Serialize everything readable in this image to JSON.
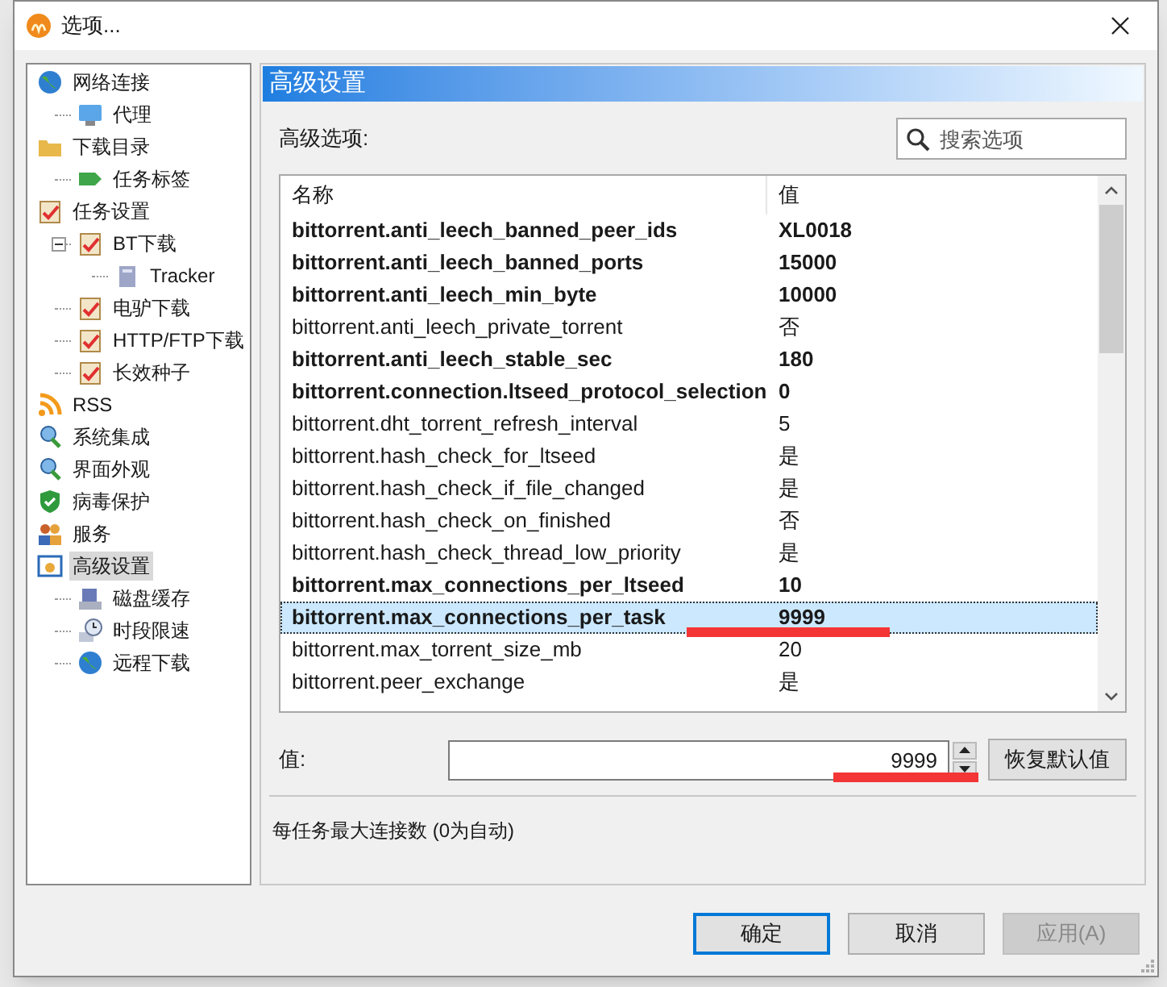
{
  "window": {
    "title": "选项..."
  },
  "tree": [
    {
      "label": "网络连接",
      "selected": false,
      "children": [
        {
          "label": "代理",
          "selected": false
        }
      ]
    },
    {
      "label": "下载目录",
      "selected": false,
      "children": [
        {
          "label": "任务标签",
          "selected": false
        }
      ]
    },
    {
      "label": "任务设置",
      "selected": false,
      "children": [
        {
          "label": "BT下载",
          "selected": false,
          "expanded": true,
          "children": [
            {
              "label": "Tracker",
              "selected": false
            }
          ]
        },
        {
          "label": "电驴下载",
          "selected": false
        },
        {
          "label": "HTTP/FTP下载",
          "selected": false
        },
        {
          "label": "长效种子",
          "selected": false
        }
      ]
    },
    {
      "label": "RSS",
      "selected": false
    },
    {
      "label": "系统集成",
      "selected": false
    },
    {
      "label": "界面外观",
      "selected": false
    },
    {
      "label": "病毒保护",
      "selected": false
    },
    {
      "label": "服务",
      "selected": false
    },
    {
      "label": "高级设置",
      "selected": true,
      "children": [
        {
          "label": "磁盘缓存",
          "selected": false
        },
        {
          "label": "时段限速",
          "selected": false
        },
        {
          "label": "远程下载",
          "selected": false
        }
      ]
    }
  ],
  "panel": {
    "title": "高级设置",
    "options_label": "高级选项:",
    "search": {
      "placeholder": "搜索选项"
    },
    "table": {
      "columns": [
        "名称",
        "值"
      ],
      "rows": [
        {
          "name": "bittorrent.anti_leech_banned_peer_ids",
          "value": "XL0018",
          "modified": true,
          "selected": false
        },
        {
          "name": "bittorrent.anti_leech_banned_ports",
          "value": "15000",
          "modified": true,
          "selected": false
        },
        {
          "name": "bittorrent.anti_leech_min_byte",
          "value": "10000",
          "modified": true,
          "selected": false
        },
        {
          "name": "bittorrent.anti_leech_private_torrent",
          "value": "否",
          "modified": false,
          "selected": false
        },
        {
          "name": "bittorrent.anti_leech_stable_sec",
          "value": "180",
          "modified": true,
          "selected": false
        },
        {
          "name": "bittorrent.connection.ltseed_protocol_selection",
          "value": "0",
          "modified": true,
          "selected": false
        },
        {
          "name": "bittorrent.dht_torrent_refresh_interval",
          "value": "5",
          "modified": false,
          "selected": false
        },
        {
          "name": "bittorrent.hash_check_for_ltseed",
          "value": "是",
          "modified": false,
          "selected": false
        },
        {
          "name": "bittorrent.hash_check_if_file_changed",
          "value": "是",
          "modified": false,
          "selected": false
        },
        {
          "name": "bittorrent.hash_check_on_finished",
          "value": "否",
          "modified": false,
          "selected": false
        },
        {
          "name": "bittorrent.hash_check_thread_low_priority",
          "value": "是",
          "modified": false,
          "selected": false
        },
        {
          "name": "bittorrent.max_connections_per_ltseed",
          "value": "10",
          "modified": true,
          "selected": false
        },
        {
          "name": "bittorrent.max_connections_per_task",
          "value": "9999",
          "modified": true,
          "selected": true
        },
        {
          "name": "bittorrent.max_torrent_size_mb",
          "value": "20",
          "modified": false,
          "selected": false
        },
        {
          "name": "bittorrent.peer_exchange",
          "value": "是",
          "modified": false,
          "selected": false
        }
      ]
    },
    "value_label": "值:",
    "value": "9999",
    "restore_button": "恢复默认值",
    "description": "每任务最大连接数 (0为自动)"
  },
  "buttons": [
    {
      "label": "确定",
      "default": true,
      "disabled": false
    },
    {
      "label": "取消",
      "default": false,
      "disabled": false
    },
    {
      "label": "应用(A)",
      "default": false,
      "disabled": true
    }
  ]
}
